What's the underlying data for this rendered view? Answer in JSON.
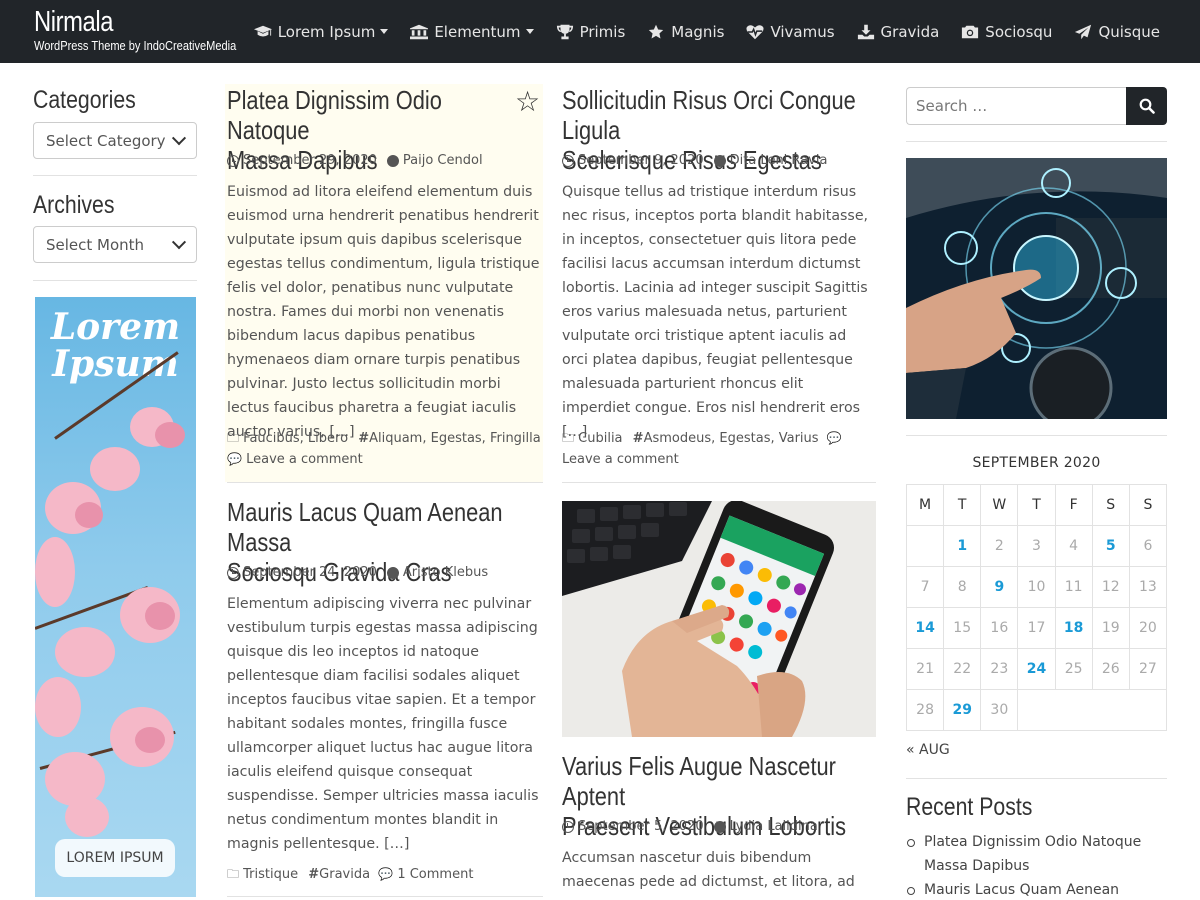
{
  "site": {
    "title": "Nirmala",
    "tagline": "WordPress Theme by IndoCreativeMedia"
  },
  "nav": {
    "items": [
      {
        "label": "Lorem Ipsum",
        "icon": "graduation-cap-icon",
        "dropdown": true
      },
      {
        "label": "Elementum",
        "icon": "bank-icon",
        "dropdown": true
      },
      {
        "label": "Primis",
        "icon": "trophy-icon",
        "dropdown": false
      },
      {
        "label": "Magnis",
        "icon": "star-icon",
        "dropdown": false
      },
      {
        "label": "Vivamus",
        "icon": "heartbeat-icon",
        "dropdown": false
      },
      {
        "label": "Gravida",
        "icon": "download-icon",
        "dropdown": false
      },
      {
        "label": "Sociosqu",
        "icon": "camera-icon",
        "dropdown": false
      },
      {
        "label": "Quisque",
        "icon": "paper-plane-icon",
        "dropdown": false
      }
    ]
  },
  "left_sidebar": {
    "categories_title": "Categories",
    "categories_select": "Select Category",
    "archives_title": "Archives",
    "archives_select": "Select Month",
    "promo": {
      "title_line1": "Lorem",
      "title_line2": "Ipsum",
      "button": "LOREM IPSUM"
    }
  },
  "posts": [
    {
      "title_line1": "Platea Dignissim Odio Natoque",
      "title_line2": "Massa Dapibus",
      "date": "September 29, 2020",
      "author": "Paijo Cendol",
      "sticky": true,
      "excerpt": "Euismod ad litora eleifend elementum duis euismod urna hendrerit penatibus hendrerit vulputate ipsum quis dapibus scelerisque egestas tellus condimentum, ligula tristique felis vel dolor, penatibus nunc vulputate nostra. Fames dui morbi non venenatis bibendum lacus dapibus penatibus hymenaeos diam ornare turpis penatibus pulvinar. Justo lectus sollicitudin morbi lectus faucibus pharetra a feugiat iaculis auctor varius, […]",
      "categories": "Faucibus, Libero",
      "tags": "Aliquam, Egestas, Fringilla",
      "comments": "Leave a comment"
    },
    {
      "title_line1": "Sollicitudin Risus Orci Congue Ligula",
      "title_line2": "Scelerisque Risus Egestas",
      "date": "September 9, 2020",
      "author": "Dita Leni Ravia",
      "excerpt": "Quisque tellus ad tristique interdum risus nec risus, inceptos porta blandit habitasse, in inceptos, consectetuer quis litora pede facilisi lacus accumsan interdum dictumst lobortis. Lacinia ad integer suscipit Sagittis eros varius malesuada netus, parturient vulputate orci tristique aptent iaculis ad orci platea dapibus, feugiat pellentesque malesuada parturient rhoncus elit imperdiet congue. Eros nisl hendrerit eros […]",
      "categories": "Cubilia",
      "tags": "Asmodeus, Egestas, Varius",
      "comments": "Leave a comment"
    },
    {
      "title_line1": "Mauris Lacus Quam Aenean Massa",
      "title_line2": "Sociosqu Gravida Cras",
      "date": "September 24, 2020",
      "author": "Aristo Klebus",
      "excerpt": "Elementum adipiscing viverra nec pulvinar vestibulum turpis egestas massa adipiscing quisque dis leo inceptos id natoque pellentesque diam facilisi sodales aliquet inceptos faucibus vitae sapien. Et a tempor habitant sodales montes, fringilla fusce ullamcorper aliquet luctus hac augue litora iaculis eleifend quisque consequat suspendisse. Semper ultricies massa iaculis netus condimentum montes blandit in magnis pellentesque. […]",
      "categories": "Tristique",
      "tags": "Gravida",
      "comments": "1 Comment"
    },
    {
      "title_line1": "Varius Felis Augue Nascetur Aptent",
      "title_line2": "Praesent Vestibulum Lobortis",
      "date": "September 5, 2020",
      "author": "Lydia Lalidina",
      "excerpt": "Accumsan nascetur duis bibendum maecenas pede ad dictumst, et litora, ad natoque quam"
    }
  ],
  "right_sidebar": {
    "search_placeholder": "Search …",
    "calendar": {
      "caption": "SEPTEMBER 2020",
      "weekdays": [
        "M",
        "T",
        "W",
        "T",
        "F",
        "S",
        "S"
      ],
      "weeks": [
        [
          "",
          "1",
          "2",
          "3",
          "4",
          "5",
          "6"
        ],
        [
          "7",
          "8",
          "9",
          "10",
          "11",
          "12",
          "13"
        ],
        [
          "14",
          "15",
          "16",
          "17",
          "18",
          "19",
          "20"
        ],
        [
          "21",
          "22",
          "23",
          "24",
          "25",
          "26",
          "27"
        ],
        [
          "28",
          "29",
          "30",
          "",
          "",
          "",
          ""
        ]
      ],
      "linked_days": [
        "1",
        "5",
        "9",
        "14",
        "18",
        "24",
        "29"
      ],
      "prev_link": "« AUG"
    },
    "recent_posts_title": "Recent Posts",
    "recent_posts": [
      "Platea Dignissim Odio Natoque Massa Dapibus",
      "Mauris Lacus Quam Aenean Massa"
    ]
  },
  "colors": {
    "header_bg": "#212529",
    "link_blue": "#1a9ad6",
    "sticky_bg": "#fffdf0"
  }
}
